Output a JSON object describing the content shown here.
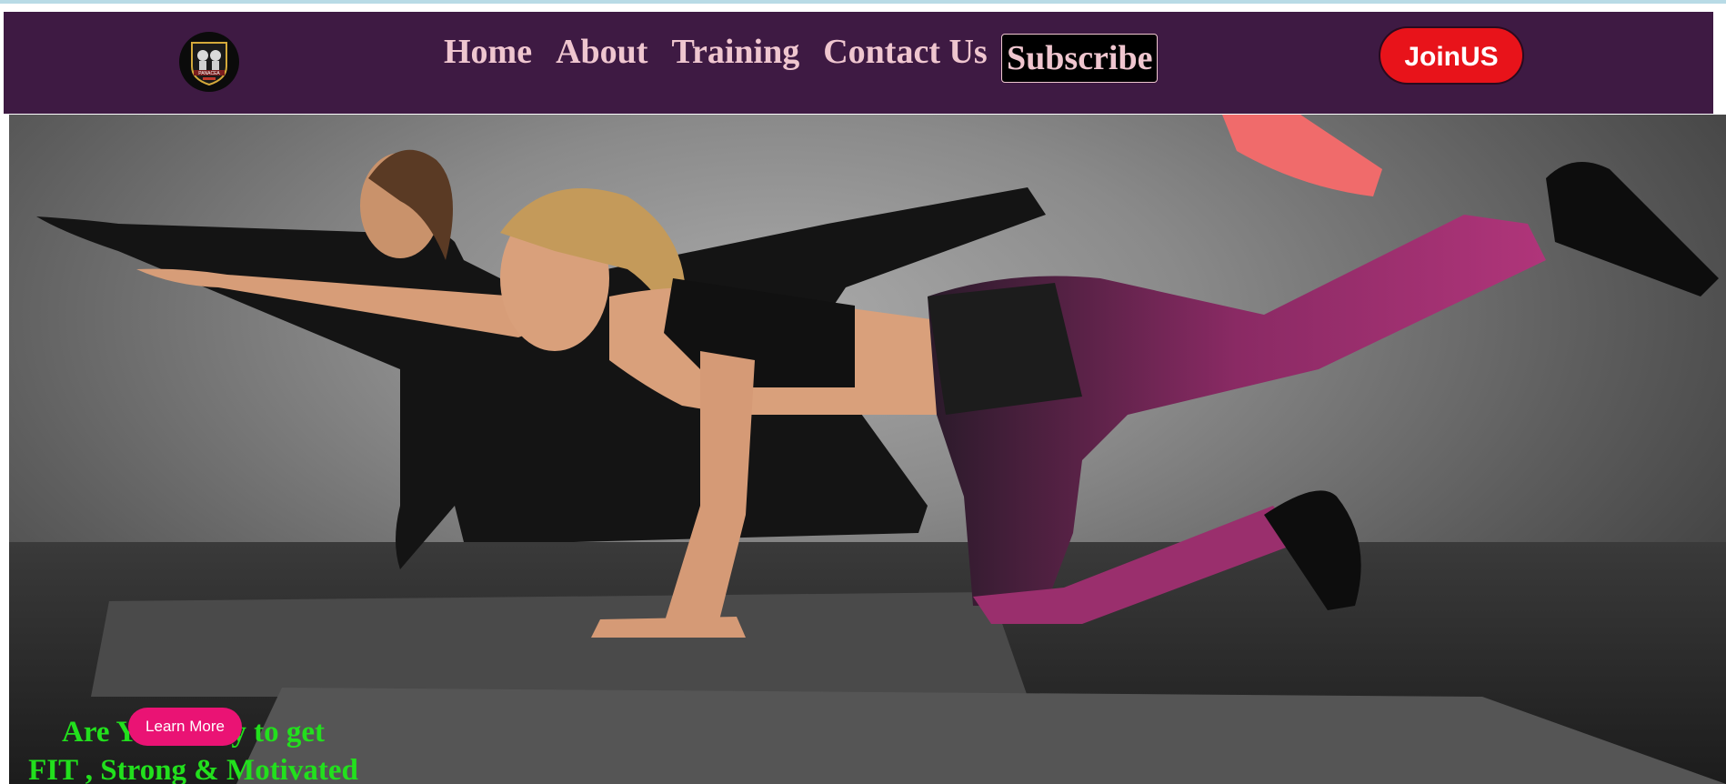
{
  "colors": {
    "navbar_bg": "#3e1a43",
    "nav_text": "#efc6cf",
    "join_bg": "#e8131a",
    "tagline": "#22e01d",
    "learn_bg": "#ea1374"
  },
  "logo": {
    "icon": "panacea-gym-crest-icon",
    "text": "PANACEA"
  },
  "nav": {
    "links": [
      {
        "label": "Home"
      },
      {
        "label": "About"
      },
      {
        "label": "Training"
      },
      {
        "label": "Contact Us"
      }
    ],
    "subscribe_label": "Subscribe",
    "join_label": "JoinUS"
  },
  "hero": {
    "image": "hero-workout-photo",
    "tagline_line1": "Are You ready to get",
    "tagline_line2": "FIT , Strong & Motivated",
    "cta_label": "Learn More"
  }
}
